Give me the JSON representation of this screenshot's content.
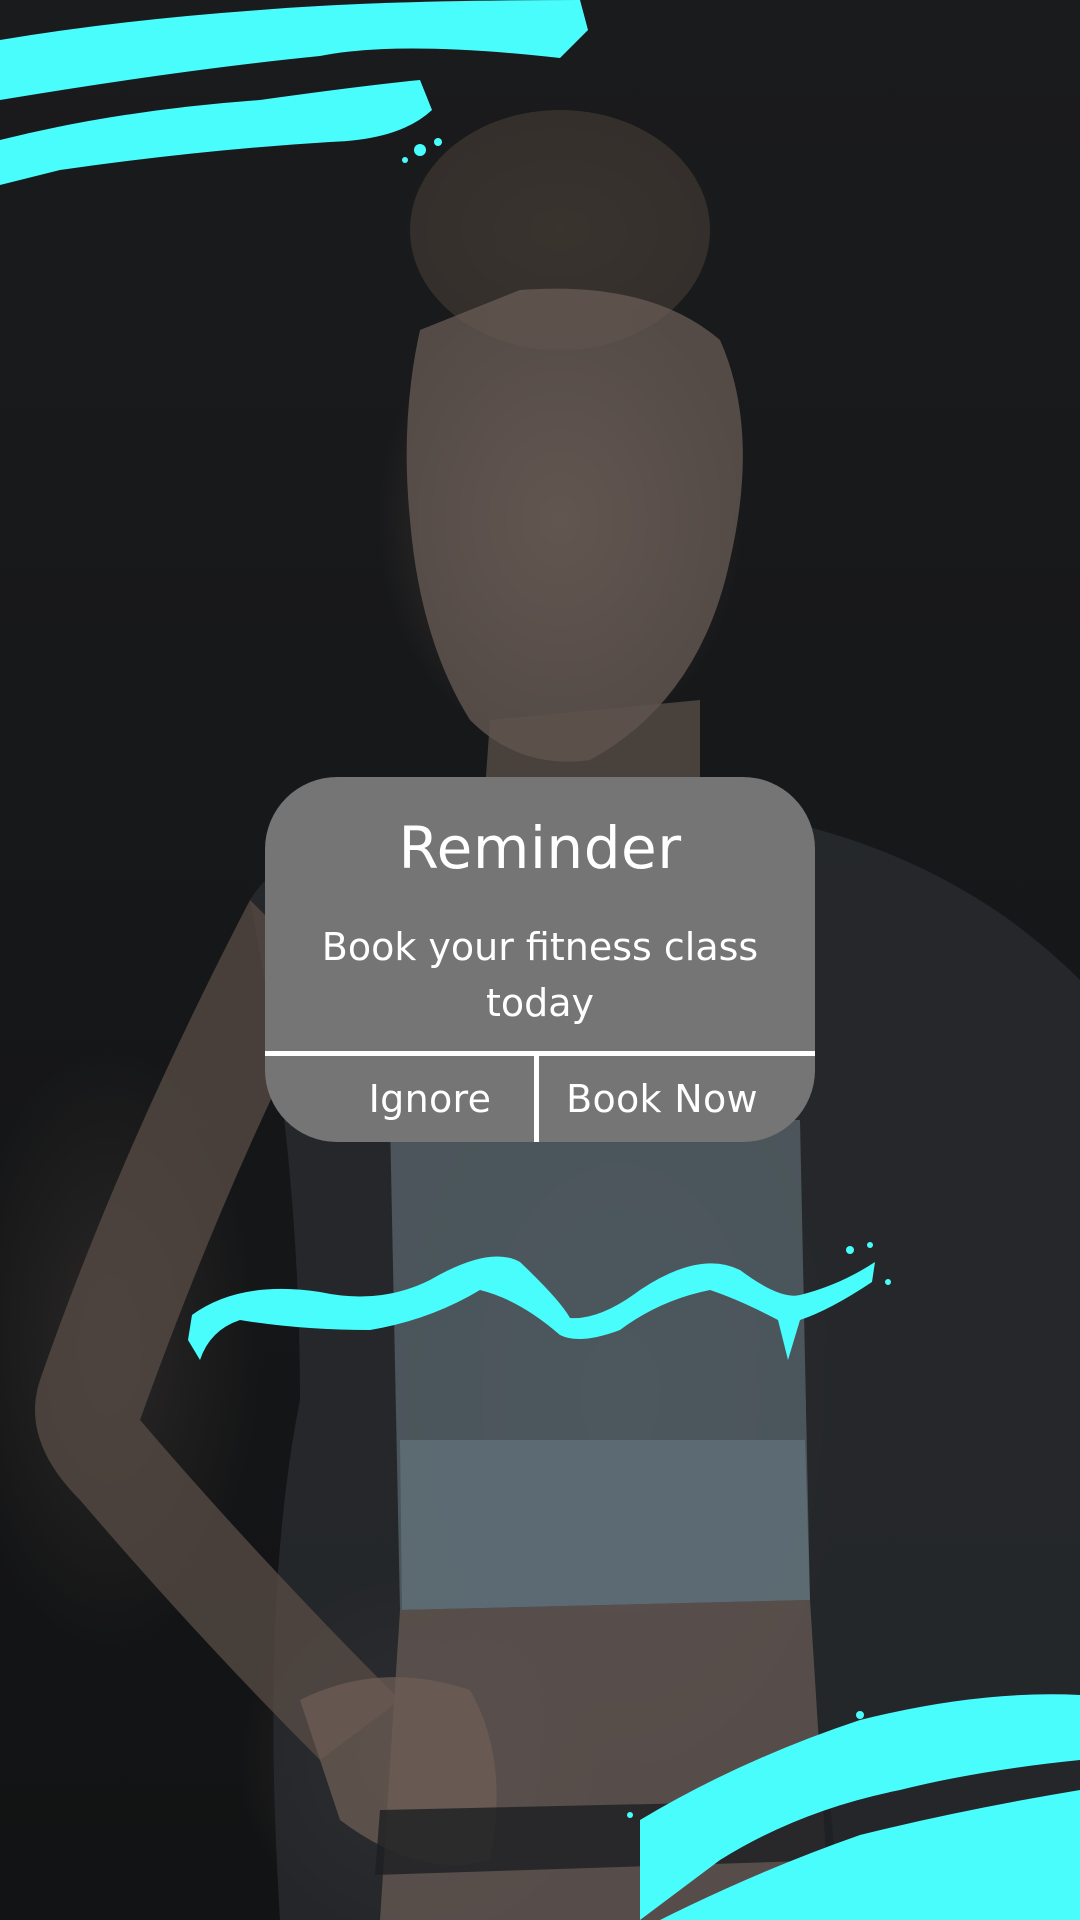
{
  "dialog": {
    "title": "Reminder",
    "message": "Book your fitness class today",
    "ignore_label": "Ignore",
    "book_label": "Book Now"
  },
  "colors": {
    "brush_accent": "#4afdfd",
    "dialog_bg": "#757575",
    "dialog_text": "#ffffff",
    "backdrop": "#141516"
  },
  "background": {
    "description": "dimmed photo of a woman in a sports top"
  }
}
